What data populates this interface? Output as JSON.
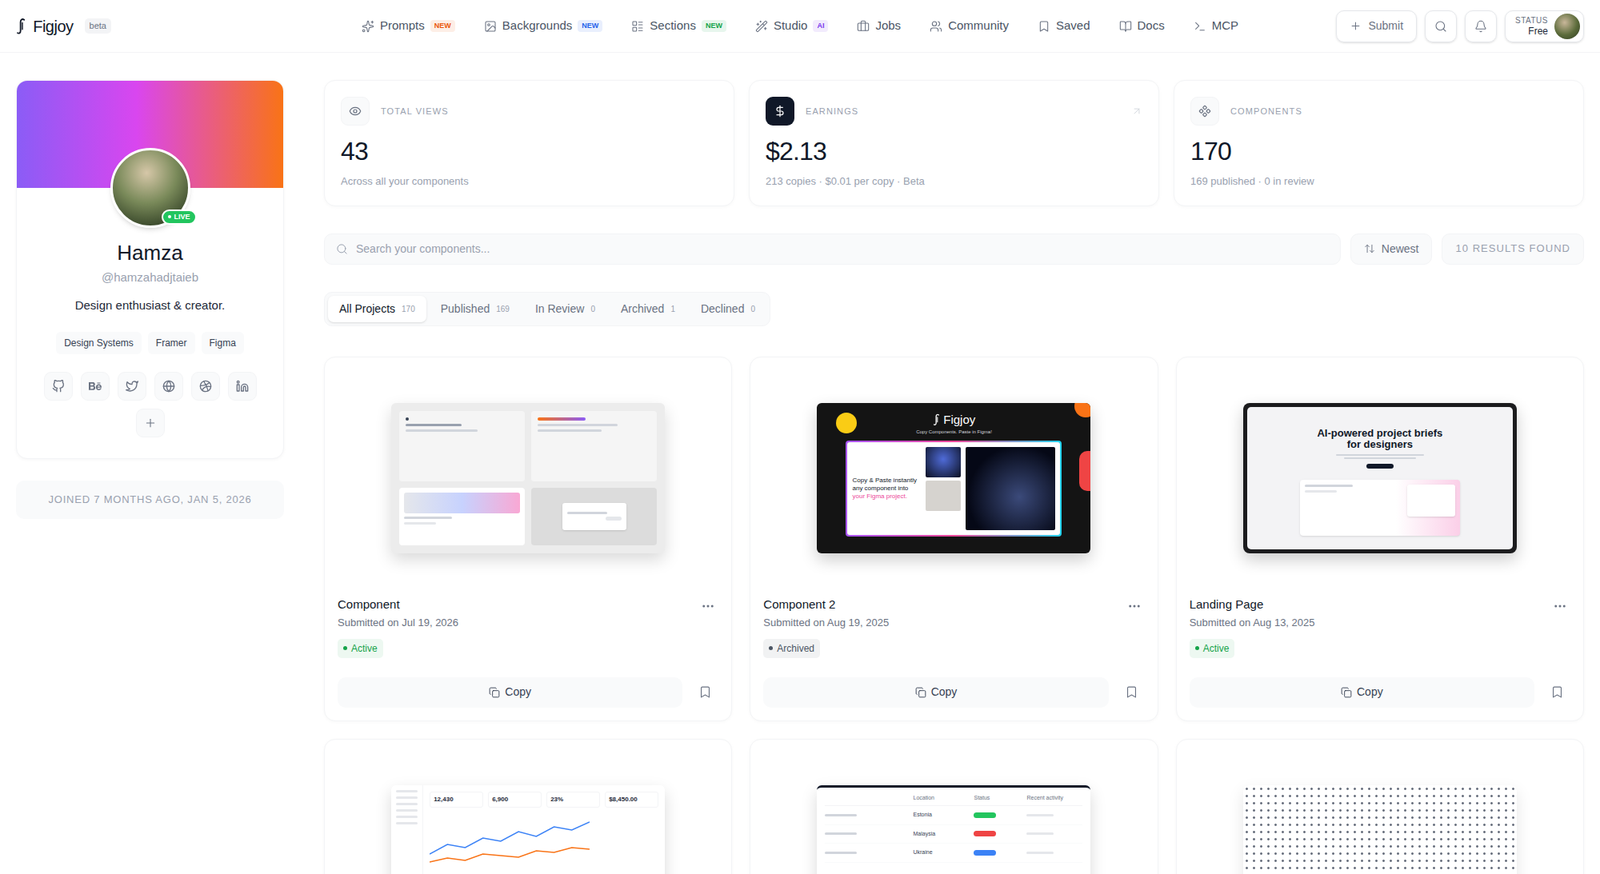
{
  "brand": {
    "name": "Figjoy",
    "badge": "beta"
  },
  "nav": [
    {
      "label": "Prompts",
      "badge": "NEW",
      "color": "#ea580c"
    },
    {
      "label": "Backgrounds",
      "badge": "NEW",
      "color": "#2563eb"
    },
    {
      "label": "Sections",
      "badge": "NEW",
      "color": "#16a34a"
    },
    {
      "label": "Studio",
      "badge": "AI",
      "color": "#7c3aed"
    },
    {
      "label": "Jobs"
    },
    {
      "label": "Community"
    },
    {
      "label": "Saved"
    },
    {
      "label": "Docs"
    },
    {
      "label": "MCP"
    }
  ],
  "actions": {
    "submit": "Submit",
    "status_label": "STATUS",
    "status_value": "Free"
  },
  "profile": {
    "name": "Hamza",
    "handle": "@hamzahadjtaieb",
    "bio": "Design enthusiast & creator.",
    "live": "LIVE",
    "tags": [
      "Design Systems",
      "Framer",
      "Figma"
    ],
    "joined": "JOINED 7 MONTHS AGO, JAN 5, 2026"
  },
  "stats": [
    {
      "label": "TOTAL VIEWS",
      "value": "43",
      "caption": "Across all your components",
      "highlighted": false
    },
    {
      "label": "EARNINGS",
      "value": "$2.13",
      "caption": "213 copies · $0.01 per copy · Beta",
      "highlighted": true
    },
    {
      "label": "COMPONENTS",
      "value": "170",
      "caption": "169 published · 0 in review",
      "highlighted": false
    }
  ],
  "search": {
    "placeholder": "Search your components...",
    "sort": "Newest",
    "results": "10 RESULTS FOUND"
  },
  "filters": [
    {
      "label": "All Projects",
      "count": "170",
      "selected": true
    },
    {
      "label": "Published",
      "count": "169",
      "selected": false
    },
    {
      "label": "In Review",
      "count": "0",
      "selected": false
    },
    {
      "label": "Archived",
      "count": "1",
      "selected": false
    },
    {
      "label": "Declined",
      "count": "0",
      "selected": false
    }
  ],
  "projects": [
    {
      "title": "Component",
      "date": "Submitted on Jul 19, 2026",
      "status": "Active",
      "color": "#16a34a",
      "action": "Copy",
      "preview": {
        "kind": "board"
      }
    },
    {
      "title": "Component 2",
      "date": "Submitted on Aug 19, 2025",
      "status": "Archived",
      "color": "#4b5563",
      "action": "Copy",
      "preview": {
        "kind": "promo",
        "logo": "Figjoy",
        "tagline": "Copy Components. Paste in Figma!",
        "headline": "Copy & Paste instantly any component into",
        "highlight": "your Figma project."
      }
    },
    {
      "title": "Landing Page",
      "date": "Submitted on Aug 13, 2025",
      "status": "Active",
      "color": "#16a34a",
      "action": "Copy",
      "preview": {
        "kind": "landing",
        "headline": "AI-powered project briefs for designers"
      }
    },
    {
      "preview": {
        "kind": "analytics",
        "stats": [
          "12,430",
          "6,900",
          "23%",
          "$8,450.00"
        ],
        "series": [
          [
            30,
            42,
            38,
            50,
            46,
            58,
            52,
            64,
            60,
            70
          ],
          [
            20,
            25,
            22,
            30,
            28,
            26,
            34,
            32,
            38,
            36
          ]
        ]
      }
    },
    {
      "preview": {
        "kind": "table",
        "columns": [
          "Location",
          "Status",
          "Recent activity"
        ],
        "rows": [
          {
            "location": "Estonia",
            "color": "#22c55e"
          },
          {
            "location": "Malaysia",
            "color": "#ef4444"
          },
          {
            "location": "Ukraine",
            "color": "#3b82f6"
          }
        ]
      }
    },
    {
      "preview": {
        "kind": "dots"
      }
    }
  ]
}
